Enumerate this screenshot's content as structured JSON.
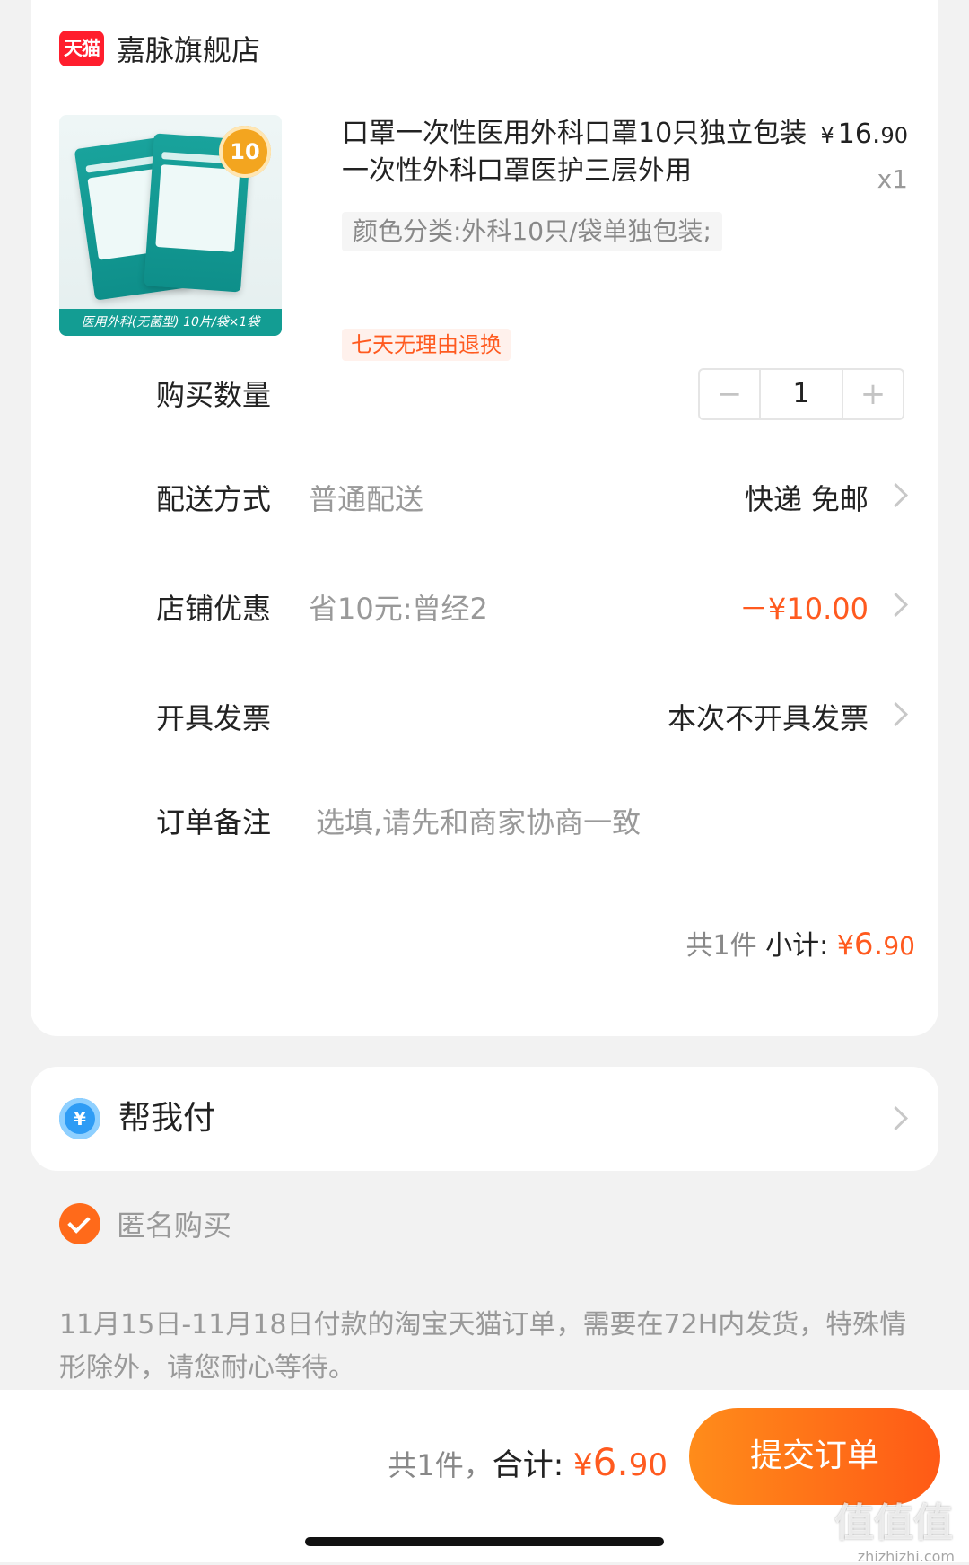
{
  "shop": {
    "logo_text": "天猫",
    "name": "嘉脉旗舰店"
  },
  "product": {
    "title": "口罩一次性医用外科口罩10只独立包装一次性外科口罩医护三层外用",
    "price_symbol": "¥",
    "price_int": "16.",
    "price_dec": "90",
    "quantity": "x1",
    "spec": "颜色分类:外科10只/袋单独包装;",
    "return_tag": "七天无理由退换",
    "image_badge": "10",
    "image_strip": "医用外科(无菌型) 10片/袋×1袋"
  },
  "purchase_qty": {
    "label": "购买数量",
    "minus": "−",
    "value": "1",
    "plus": "+"
  },
  "delivery": {
    "label": "配送方式",
    "sub": "普通配送",
    "value": "快递 免邮"
  },
  "shop_discount": {
    "label": "店铺优惠",
    "sub": "省10元:曾经2",
    "value": "－¥10.00"
  },
  "invoice": {
    "label": "开具发票",
    "value": "本次不开具发票"
  },
  "order_note": {
    "label": "订单备注",
    "placeholder": "选填,请先和商家协商一致"
  },
  "subtotal": {
    "count": "共1件",
    "label": "小计:",
    "symbol": "¥",
    "int": "6.",
    "dec": "90"
  },
  "help_pay": {
    "icon": "¥",
    "label": "帮我付"
  },
  "anonymous": {
    "label": "匿名购买",
    "checked": true
  },
  "notice": "11月15日-11月18日付款的淘宝天猫订单，需要在72H内发货，特殊情形除外，请您耐心等待。",
  "footer": {
    "count": "共1件，",
    "label": "合计:",
    "symbol": "¥",
    "int": "6.",
    "dec": "90",
    "submit": "提交订单",
    "watermark": "值值值",
    "watermark_url": "zhizhizhi.com"
  },
  "colors": {
    "accent": "#ff5a1f",
    "button_start": "#ff8c1a",
    "button_end": "#ff5a16",
    "tmall_red": "#ff1e2d"
  }
}
